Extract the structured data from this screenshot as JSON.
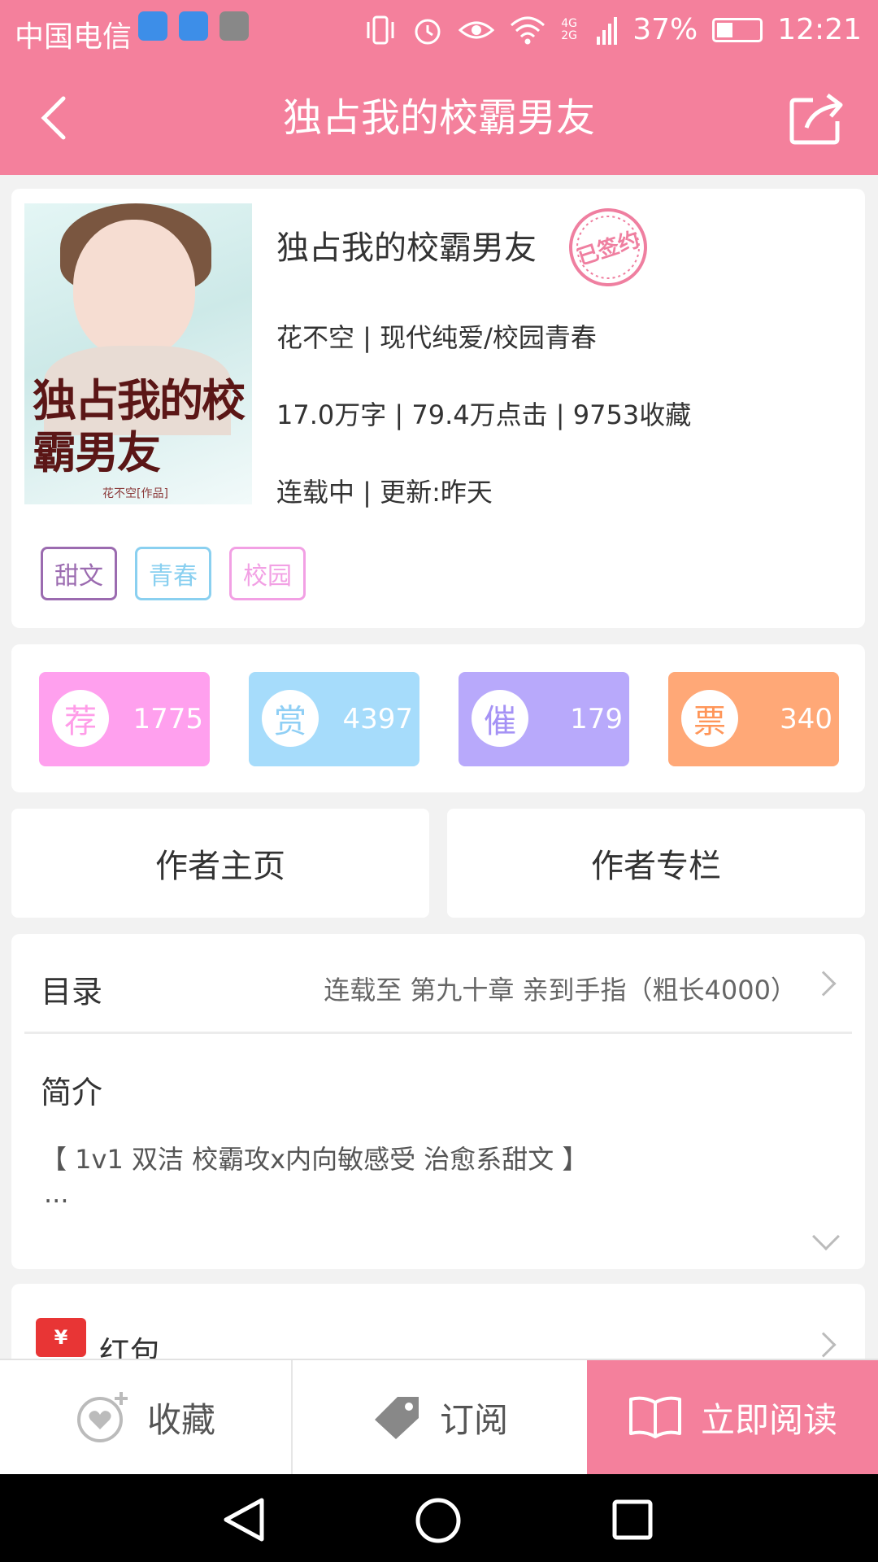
{
  "status_bar": {
    "carrier": "中国电信",
    "network": "4G 2G",
    "battery": "37%",
    "battery_level": 0.37,
    "time": "12:21"
  },
  "header": {
    "title": "独占我的校霸男友"
  },
  "book": {
    "cover_title": "独占我的校霸男友",
    "cover_author": "花不空[作品]",
    "title": "独占我的校霸男友",
    "signed_badge": "已签约",
    "author_category": "花不空 | 现代纯爱/校园青春",
    "stats_line": "17.0万字 | 79.4万点击 | 9753收藏",
    "status_line": "连载中 | 更新:昨天",
    "tags": [
      {
        "label": "甜文",
        "color": "#9b6bb0"
      },
      {
        "label": "青春",
        "color": "#8ad0f0"
      },
      {
        "label": "校园",
        "color": "#f2a0e4"
      }
    ]
  },
  "stats": [
    {
      "icon_char": "荐",
      "count": "1775",
      "bg": "#ffa0ee",
      "fg": "#ff9ce8"
    },
    {
      "icon_char": "赏",
      "count": "4397",
      "bg": "#a6dcfb",
      "fg": "#8fcff5"
    },
    {
      "icon_char": "催",
      "count": "179",
      "bg": "#b8a9fb",
      "fg": "#a592f5"
    },
    {
      "icon_char": "票",
      "count": "340",
      "bg": "#ffa877",
      "fg": "#ff9659"
    }
  ],
  "author_buttons": {
    "home": "作者主页",
    "column": "作者专栏"
  },
  "toc": {
    "label": "目录",
    "status": "连载至 第九十章 亲到手指（粗长4000）"
  },
  "intro": {
    "label": "简介",
    "text": "【 1v1 双洁 校霸攻x内向敏感受 治愈系甜文 】",
    "more": "..."
  },
  "red_packet": {
    "icon_char": "¥",
    "label": "红包"
  },
  "bottom_bar": {
    "favorite": "收藏",
    "subscribe": "订阅",
    "read_now": "立即阅读"
  },
  "colors": {
    "accent": "#f4809c"
  }
}
